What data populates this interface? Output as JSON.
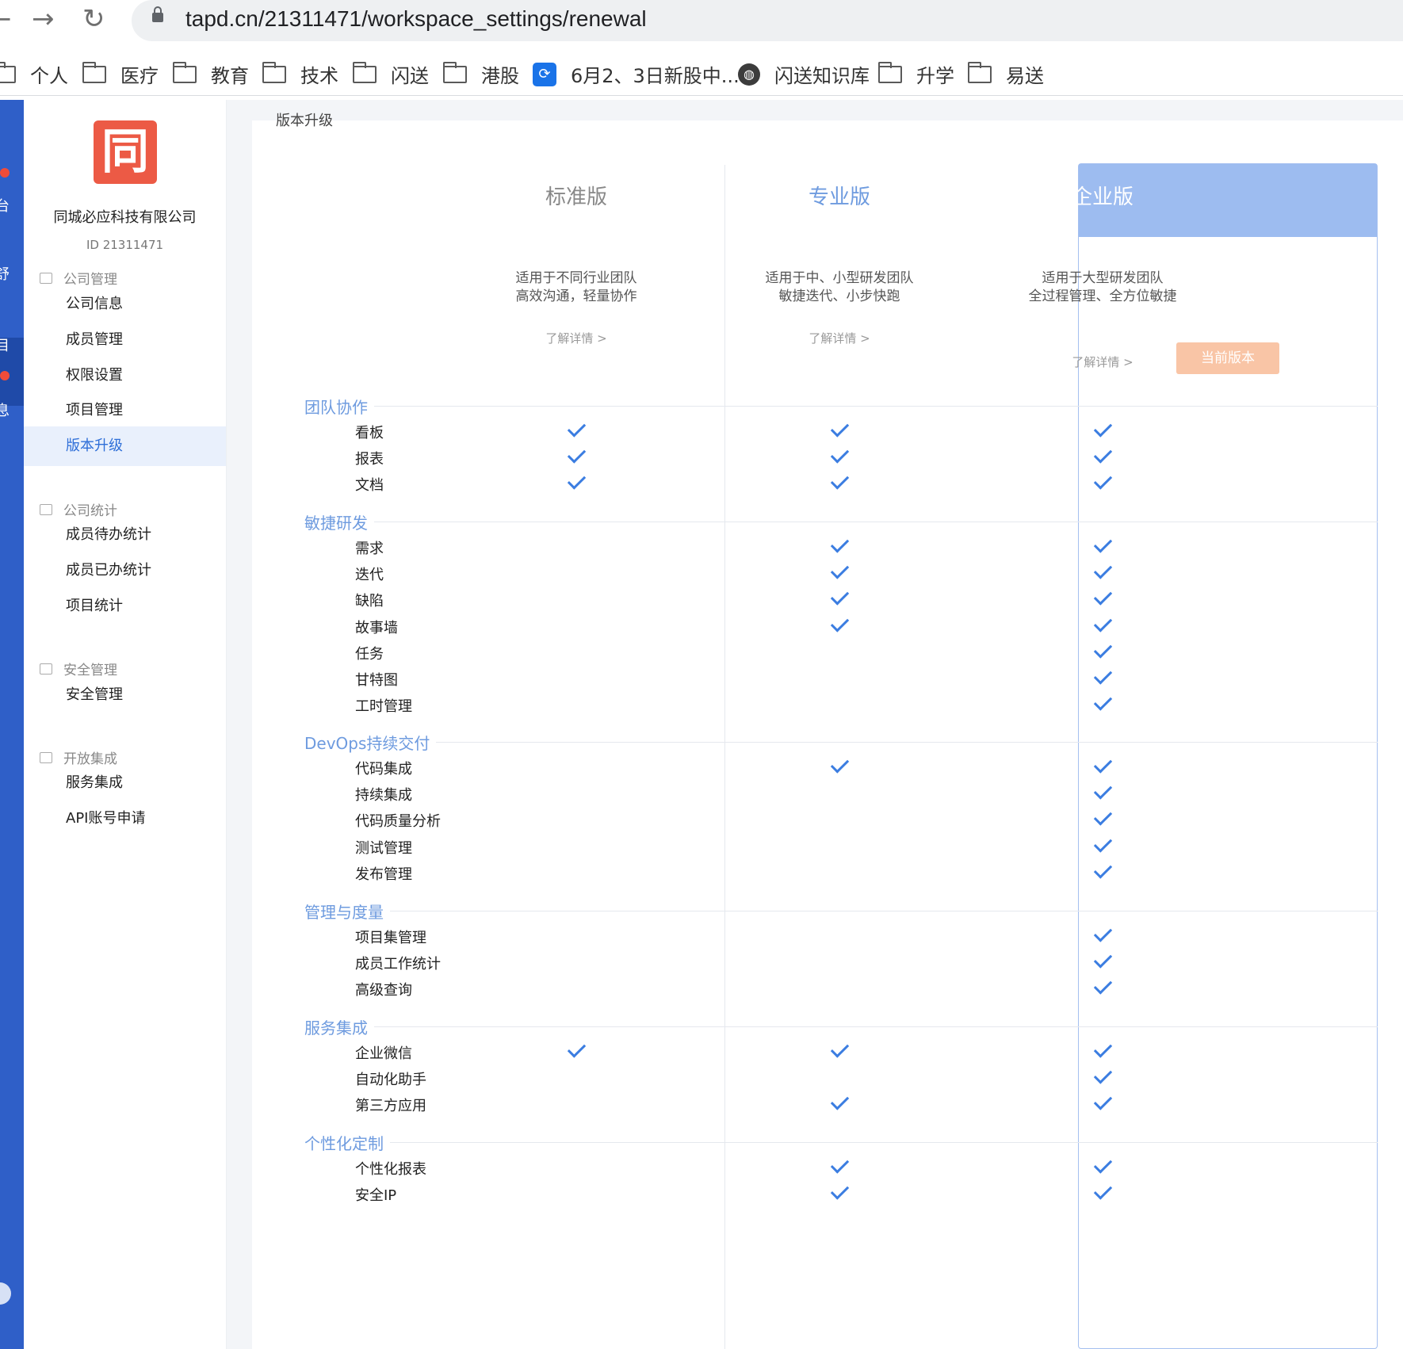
{
  "browser": {
    "url": "tapd.cn/21311471/workspace_settings/renewal",
    "bookmarks": [
      {
        "label": "个人",
        "icon": "folder-icon"
      },
      {
        "label": "医疗",
        "icon": "folder-icon"
      },
      {
        "label": "教育",
        "icon": "folder-icon"
      },
      {
        "label": "技术",
        "icon": "folder-icon"
      },
      {
        "label": "闪送",
        "icon": "folder-icon"
      },
      {
        "label": "港股",
        "icon": "folder-icon"
      },
      {
        "label": "6月2、3日新股中...",
        "icon": "app-icon"
      },
      {
        "label": "闪送知识库",
        "icon": "globe-icon"
      },
      {
        "label": "升学",
        "icon": "folder-icon"
      },
      {
        "label": "易送",
        "icon": "folder-icon"
      }
    ]
  },
  "leftbar": {
    "labels": [
      "台",
      "舒",
      "目",
      "息"
    ]
  },
  "sidebar": {
    "logo_text": "同",
    "company_name": "同城必应科技有限公司",
    "company_id": "ID 21311471",
    "groups": [
      {
        "title": "公司管理",
        "items": [
          "公司信息",
          "成员管理",
          "权限设置",
          "项目管理",
          "版本升级"
        ]
      },
      {
        "title": "公司统计",
        "items": [
          "成员待办统计",
          "成员已办统计",
          "项目统计"
        ]
      },
      {
        "title": "安全管理",
        "items": [
          "安全管理"
        ]
      },
      {
        "title": "开放集成",
        "items": [
          "服务集成",
          "API账号申请"
        ]
      }
    ],
    "active_item": "版本升级"
  },
  "page": {
    "title": "版本升级",
    "plans": [
      {
        "name": "标准版",
        "desc1": "适用于不同行业团队",
        "desc2": "高效沟通，轻量协作",
        "link": "了解详情 >"
      },
      {
        "name": "专业版",
        "desc1": "适用于中、小型研发团队",
        "desc2": "敏捷迭代、小步快跑",
        "link": "了解详情 >"
      },
      {
        "name": "企业版",
        "desc1": "适用于大型研发团队",
        "desc2": "全过程管理、全方位敏捷",
        "link": "了解详情 >",
        "badge": "当前版本"
      }
    ],
    "colors": {
      "accent": "#3b7de1",
      "section": "#6e9bdf",
      "enterprise_header": "#9dbcf0",
      "current_badge": "#f9c5a6"
    },
    "sections": [
      {
        "title": "团队协作",
        "features": [
          {
            "name": "看板",
            "plans": [
              true,
              true,
              true
            ]
          },
          {
            "name": "报表",
            "plans": [
              true,
              true,
              true
            ]
          },
          {
            "name": "文档",
            "plans": [
              true,
              true,
              true
            ]
          }
        ]
      },
      {
        "title": "敏捷研发",
        "features": [
          {
            "name": "需求",
            "plans": [
              false,
              true,
              true
            ]
          },
          {
            "name": "迭代",
            "plans": [
              false,
              true,
              true
            ]
          },
          {
            "name": "缺陷",
            "plans": [
              false,
              true,
              true
            ]
          },
          {
            "name": "故事墙",
            "plans": [
              false,
              true,
              true
            ]
          },
          {
            "name": "任务",
            "plans": [
              false,
              false,
              true
            ]
          },
          {
            "name": "甘特图",
            "plans": [
              false,
              false,
              true
            ]
          },
          {
            "name": "工时管理",
            "plans": [
              false,
              false,
              true
            ]
          }
        ]
      },
      {
        "title": "DevOps持续交付",
        "features": [
          {
            "name": "代码集成",
            "plans": [
              false,
              true,
              true
            ]
          },
          {
            "name": "持续集成",
            "plans": [
              false,
              false,
              true
            ]
          },
          {
            "name": "代码质量分析",
            "plans": [
              false,
              false,
              true
            ]
          },
          {
            "name": "测试管理",
            "plans": [
              false,
              false,
              true
            ]
          },
          {
            "name": "发布管理",
            "plans": [
              false,
              false,
              true
            ]
          }
        ]
      },
      {
        "title": "管理与度量",
        "features": [
          {
            "name": "项目集管理",
            "plans": [
              false,
              false,
              true
            ]
          },
          {
            "name": "成员工作统计",
            "plans": [
              false,
              false,
              true
            ]
          },
          {
            "name": "高级查询",
            "plans": [
              false,
              false,
              true
            ]
          }
        ]
      },
      {
        "title": "服务集成",
        "features": [
          {
            "name": "企业微信",
            "plans": [
              true,
              true,
              true
            ]
          },
          {
            "name": "自动化助手",
            "plans": [
              false,
              false,
              true
            ]
          },
          {
            "name": "第三方应用",
            "plans": [
              false,
              true,
              true
            ]
          }
        ]
      },
      {
        "title": "个性化定制",
        "features": [
          {
            "name": "个性化报表",
            "plans": [
              false,
              true,
              true
            ]
          },
          {
            "name": "安全IP",
            "plans": [
              false,
              true,
              true
            ]
          }
        ]
      }
    ]
  }
}
